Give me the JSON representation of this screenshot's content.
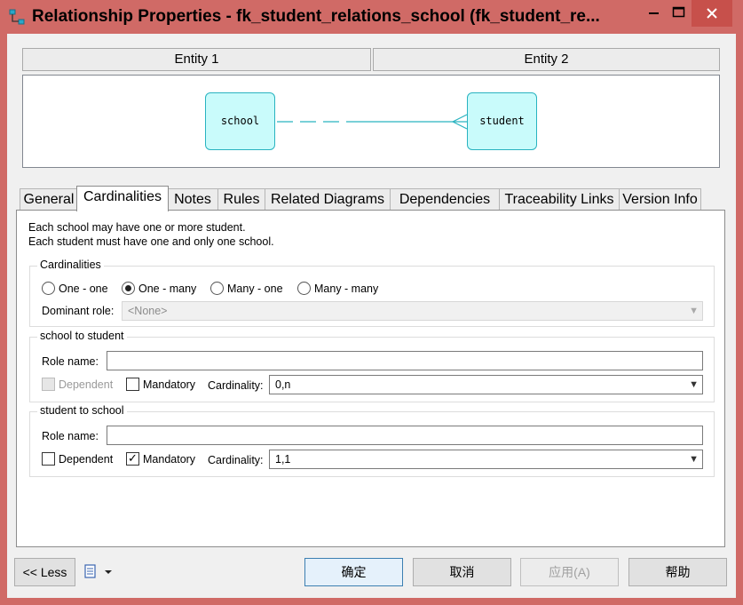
{
  "window": {
    "title": "Relationship Properties - fk_student_relations_school (fk_student_re...",
    "controls": {
      "minimize_icon": "minimize-icon",
      "maximize_icon": "maximize-icon",
      "close_icon": "close-icon"
    }
  },
  "entities": {
    "entity1_header": "Entity 1",
    "entity2_header": "Entity 2",
    "entity1_name": "school",
    "entity2_name": "student"
  },
  "tabs": [
    {
      "label": "General"
    },
    {
      "label": "Cardinalities",
      "active": true
    },
    {
      "label": "Notes"
    },
    {
      "label": "Rules"
    },
    {
      "label": "Related Diagrams"
    },
    {
      "label": "Dependencies"
    },
    {
      "label": "Traceability Links"
    },
    {
      "label": "Version Info"
    }
  ],
  "cardinalities_tab": {
    "description_line1": "Each school may have one or more student.",
    "description_line2": "Each student must have one and only one school.",
    "cardinalities_group": {
      "legend": "Cardinalities",
      "options": [
        {
          "label": "One - one",
          "selected": false
        },
        {
          "label": "One - many",
          "selected": true
        },
        {
          "label": "Many - one",
          "selected": false
        },
        {
          "label": "Many - many",
          "selected": false
        }
      ],
      "dominant_role_label": "Dominant role:",
      "dominant_role_value": "<None>"
    },
    "school_to_student": {
      "legend": "school to student",
      "role_name_label": "Role name:",
      "role_name_value": "",
      "dependent_label": "Dependent",
      "dependent_checked": false,
      "mandatory_label": "Mandatory",
      "mandatory_checked": false,
      "cardinality_label": "Cardinality:",
      "cardinality_value": "0,n"
    },
    "student_to_school": {
      "legend": "student to school",
      "role_name_label": "Role name:",
      "role_name_value": "",
      "dependent_label": "Dependent",
      "dependent_checked": false,
      "mandatory_label": "Mandatory",
      "mandatory_checked": true,
      "mandatory_mark": "✓",
      "cardinality_label": "Cardinality:",
      "cardinality_value": "1,1"
    }
  },
  "footer": {
    "less_button": "<< Less",
    "print_icon": "print-icon",
    "ok_button": "确定",
    "cancel_button": "取消",
    "apply_button": "应用(A)",
    "help_button": "帮助"
  },
  "colors": {
    "frame": "#d06a66",
    "entity_fill": "#c9fbfb",
    "entity_border": "#29b3c0",
    "link_line": "#29b3c0"
  }
}
